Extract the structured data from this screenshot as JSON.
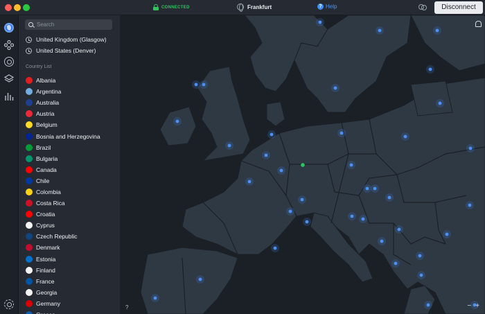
{
  "titlebar": {
    "status": "CONNECTED",
    "server": "Frankfurt",
    "help": "Help",
    "disconnect": "Disconnect"
  },
  "sidebar": {
    "search_placeholder": "Search",
    "recent": [
      "United Kingdom (Glasgow)",
      "United States (Denver)"
    ],
    "section_label": "Country List",
    "countries": [
      {
        "name": "Albania",
        "flag": "#e41e20"
      },
      {
        "name": "Argentina",
        "flag": "#74acdf"
      },
      {
        "name": "Australia",
        "flag": "#1f3f8f"
      },
      {
        "name": "Austria",
        "flag": "#ed2939"
      },
      {
        "name": "Belgium",
        "flag": "#fdda24"
      },
      {
        "name": "Bosnia and Herzegovina",
        "flag": "#002395"
      },
      {
        "name": "Brazil",
        "flag": "#009c3b"
      },
      {
        "name": "Bulgaria",
        "flag": "#00966e"
      },
      {
        "name": "Canada",
        "flag": "#ff0000"
      },
      {
        "name": "Chile",
        "flag": "#0039a6"
      },
      {
        "name": "Colombia",
        "flag": "#fcd116"
      },
      {
        "name": "Costa Rica",
        "flag": "#ce1126"
      },
      {
        "name": "Croatia",
        "flag": "#ff0000"
      },
      {
        "name": "Cyprus",
        "flag": "#f5f5f5"
      },
      {
        "name": "Czech Republic",
        "flag": "#11457e"
      },
      {
        "name": "Denmark",
        "flag": "#c60c30"
      },
      {
        "name": "Estonia",
        "flag": "#0072ce"
      },
      {
        "name": "Finland",
        "flag": "#f5f5f5"
      },
      {
        "name": "France",
        "flag": "#0055a4"
      },
      {
        "name": "Georgia",
        "flag": "#f5f5f5"
      },
      {
        "name": "Germany",
        "flag": "#dd0000"
      },
      {
        "name": "Greece",
        "flag": "#0d5eaf"
      }
    ]
  },
  "map": {
    "connected_server": "Frankfurt",
    "zoom_out": "−",
    "zoom_in": "+",
    "help_mark": "?"
  }
}
